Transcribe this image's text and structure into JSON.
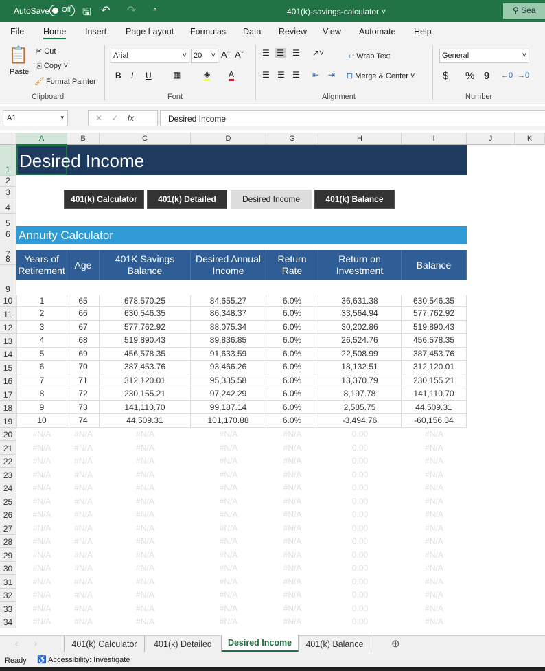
{
  "titlebar": {
    "autosave": "AutoSave",
    "toggle": "Off",
    "filename": "401(k)-savings-calculator",
    "search": "Sea"
  },
  "menu": [
    "File",
    "Home",
    "Insert",
    "Page Layout",
    "Formulas",
    "Data",
    "Review",
    "View",
    "Automate",
    "Help"
  ],
  "ribbon": {
    "paste": "Paste",
    "cut": "Cut",
    "copy": "Copy",
    "format_painter": "Format Painter",
    "clipboard": "Clipboard",
    "font_name": "Arial",
    "font_size": "20",
    "font": "Font",
    "bold": "B",
    "italic": "I",
    "underline": "U",
    "wrap_text": "Wrap Text",
    "merge_center": "Merge & Center",
    "alignment": "Alignment",
    "number_format": "General",
    "number": "Number",
    "dollar": "$",
    "percent": "%",
    "comma": "9"
  },
  "formula_bar": {
    "name_box": "A1",
    "formula": "Desired Income"
  },
  "columns": [
    "A",
    "B",
    "C",
    "D",
    "G",
    "H",
    "I",
    "J",
    "K"
  ],
  "sheet": {
    "title": "Desired Income",
    "nav_buttons": [
      "401(k) Calculator",
      "401(k) Detailed",
      "Desired Income",
      "401(k) Balance"
    ],
    "section": "Annuity Calculator",
    "headers": [
      "Years of Retirement",
      "Age",
      "401K Savings Balance",
      "Desired Annual Income",
      "Return Rate",
      "Return on Investment",
      "Balance"
    ],
    "rows": [
      [
        "1",
        "65",
        "678,570.25",
        "84,655.27",
        "6.0%",
        "36,631.38",
        "630,546.35"
      ],
      [
        "2",
        "66",
        "630,546.35",
        "86,348.37",
        "6.0%",
        "33,564.94",
        "577,762.92"
      ],
      [
        "3",
        "67",
        "577,762.92",
        "88,075.34",
        "6.0%",
        "30,202.86",
        "519,890.43"
      ],
      [
        "4",
        "68",
        "519,890.43",
        "89,836.85",
        "6.0%",
        "26,524.76",
        "456,578.35"
      ],
      [
        "5",
        "69",
        "456,578.35",
        "91,633.59",
        "6.0%",
        "22,508.99",
        "387,453.76"
      ],
      [
        "6",
        "70",
        "387,453.76",
        "93,466.26",
        "6.0%",
        "18,132.51",
        "312,120.01"
      ],
      [
        "7",
        "71",
        "312,120.01",
        "95,335.58",
        "6.0%",
        "13,370.79",
        "230,155.21"
      ],
      [
        "8",
        "72",
        "230,155.21",
        "97,242.29",
        "6.0%",
        "8,197.78",
        "141,110.70"
      ],
      [
        "9",
        "73",
        "141,110.70",
        "99,187.14",
        "6.0%",
        "2,585.75",
        "44,509.31"
      ],
      [
        "10",
        "74",
        "44,509.31",
        "101,170.88",
        "6.0%",
        "-3,494.76",
        "-60,156.34"
      ]
    ],
    "na_row": [
      "#N/A",
      "#N/A",
      "#N/A",
      "#N/A",
      "#N/A",
      "0.00",
      "#N/A"
    ],
    "row_numbers": [
      "1",
      "2",
      "3",
      "4",
      "5",
      "6",
      "7",
      "8",
      "9",
      "10",
      "11",
      "12",
      "13",
      "14",
      "15",
      "16",
      "17",
      "18",
      "19",
      "20",
      "21",
      "22",
      "23",
      "24",
      "25",
      "26",
      "27",
      "28",
      "29",
      "30",
      "31",
      "32",
      "33",
      "34"
    ]
  },
  "tabs": [
    "401(k) Calculator",
    "401(k) Detailed",
    "Desired Income",
    "401(k) Balance"
  ],
  "active_tab": "Desired Income",
  "status": {
    "ready": "Ready",
    "accessibility": "Accessibility: Investigate"
  },
  "colors": {
    "excel_green": "#217346",
    "title_band": "#1f3a5f",
    "section_band": "#2e9ad6",
    "header_band": "#2e5e95"
  }
}
